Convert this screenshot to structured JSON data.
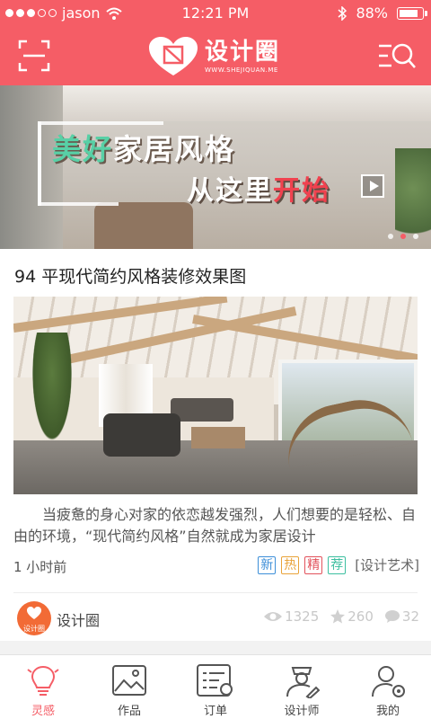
{
  "status_bar": {
    "carrier": "jason",
    "time": "12:21 PM",
    "battery": "88%",
    "battery_level": 0.88
  },
  "header": {
    "logo_title": "设计圈",
    "logo_url": "WWW.SHEJIQUAN.ME"
  },
  "banner": {
    "line1_highlight": "美好",
    "line1_rest": "家居风格",
    "line2_plain": "从这里",
    "line2_highlight": "开始",
    "pages": 3,
    "active_page": 2
  },
  "post": {
    "title": "94 平现代简约风格装修效果图",
    "description": "当疲惫的身心对家的依恋越发强烈，人们想要的是轻松、自由的环境，“现代简约风格”自然就成为家居设计",
    "time": "1 小时前",
    "tags": [
      "新",
      "热",
      "精",
      "荐"
    ],
    "category": "[设计艺术]",
    "author": "设计圈",
    "avatar_label": "设计圈",
    "views": "1325",
    "likes": "260",
    "comments": "32"
  },
  "tabbar": {
    "items": [
      {
        "label": "灵感",
        "icon": "lightbulb-icon",
        "active": true
      },
      {
        "label": "作品",
        "icon": "image-icon",
        "active": false
      },
      {
        "label": "订单",
        "icon": "order-list-icon",
        "active": false
      },
      {
        "label": "设计师",
        "icon": "designer-icon",
        "active": false
      },
      {
        "label": "我的",
        "icon": "profile-icon",
        "active": false
      }
    ]
  },
  "colors": {
    "brand": "#f55d66",
    "tag_new": "#3d8fd8",
    "tag_hot": "#e9a33a",
    "tag_best": "#e2525c",
    "tag_rec": "#3dbfa0"
  }
}
